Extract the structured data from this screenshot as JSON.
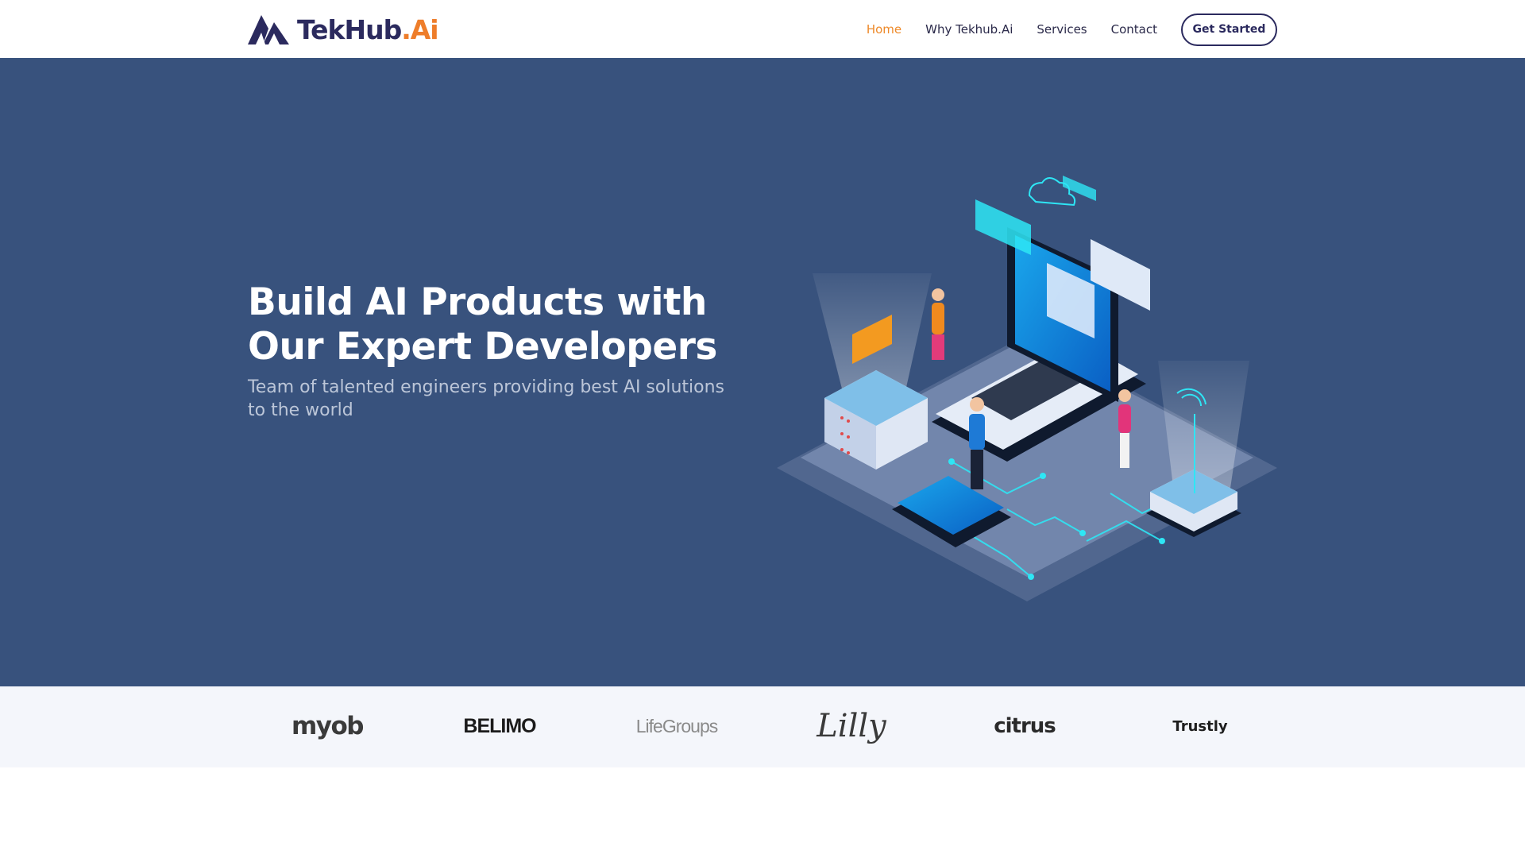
{
  "brand": {
    "name_main": "TekHub",
    "name_accent": ".Ai",
    "logo_icon": "mountain-peaks-logo",
    "primary_color": "#2b2a5e",
    "accent_color": "#ee7d2a"
  },
  "nav": {
    "items": [
      {
        "label": "Home",
        "active": true
      },
      {
        "label": "Why Tekhub.Ai",
        "active": false
      },
      {
        "label": "Services",
        "active": false
      },
      {
        "label": "Contact",
        "active": false
      }
    ],
    "cta_label": "Get Started"
  },
  "hero": {
    "title": "Build AI Products with Our Expert Developers",
    "subtitle": "Team of talented engineers providing best AI solutions to the world",
    "background_color": "#38527d",
    "illustration": "isometric-laptop-servers-people-illustration"
  },
  "clients": [
    {
      "name": "myob"
    },
    {
      "name": "BELIMO"
    },
    {
      "name": "LifeGroups"
    },
    {
      "name": "Lilly"
    },
    {
      "name": "citrus"
    },
    {
      "name": "Trustly"
    }
  ]
}
